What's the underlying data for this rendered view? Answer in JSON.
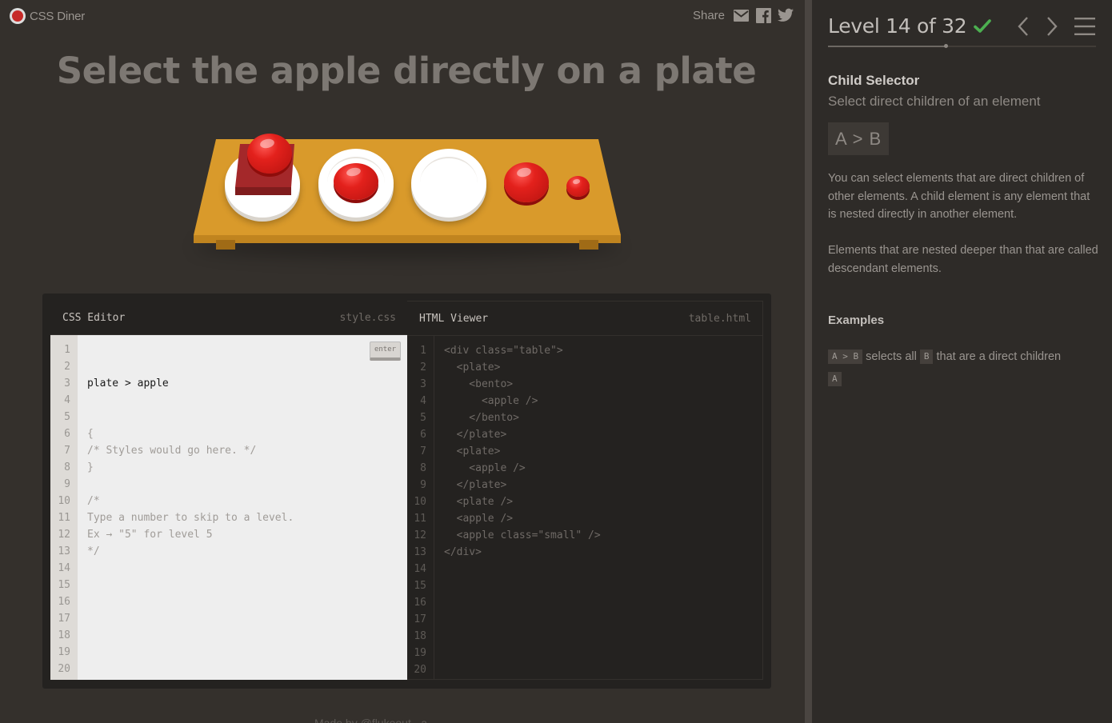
{
  "header": {
    "logo_text": "CSS Diner",
    "share_label": "Share"
  },
  "order": "Select the apple directly on a plate",
  "css_editor": {
    "title": "CSS Editor",
    "filename": "style.css",
    "input_value": "plate > apple",
    "enter_label": "enter",
    "lines": [
      "{",
      "/* Styles would go here. */",
      "}",
      "",
      "/*",
      "Type a number to skip to a level.",
      "Ex → \"5\" for level 5",
      "*/"
    ],
    "line_count": 20
  },
  "html_viewer": {
    "title": "HTML Viewer",
    "filename": "table.html",
    "lines": [
      "<div class=\"table\">",
      "  <plate>",
      "    <bento>",
      "      <apple />",
      "    </bento>",
      "  </plate>",
      "  <plate>",
      "    <apple />",
      "  </plate>",
      "  <plate />",
      "  <apple />",
      "  <apple class=\"small\" />",
      "</div>"
    ],
    "line_count": 20
  },
  "footer_text": "Made by @flukeout · a…",
  "sidebar": {
    "level_title": "Level 14 of 32",
    "level_current": 14,
    "level_total": 32,
    "completed": true,
    "selector_name": "Child Selector",
    "title": "Select direct children of an element",
    "syntax": "A > B",
    "hint_1": "You can select elements that are direct children of other elements. A child element is any element that is nested directly in another element.",
    "hint_2": "Elements that are nested deeper than that are called descendant elements.",
    "examples_title": "Examples",
    "example": {
      "code": "A > B",
      "text_1": "selects all",
      "code_2": "B",
      "text_2": "that are a direct children",
      "code_3": "A"
    }
  },
  "colors": {
    "background": "#34302c",
    "sidebar": "#2e2b28",
    "table": "#d99a2b",
    "apple": "#e3211c",
    "check": "#4caf50"
  },
  "icons": [
    "email-icon",
    "facebook-icon",
    "twitter-icon",
    "check-icon",
    "chevron-left-icon",
    "chevron-right-icon",
    "menu-icon"
  ]
}
